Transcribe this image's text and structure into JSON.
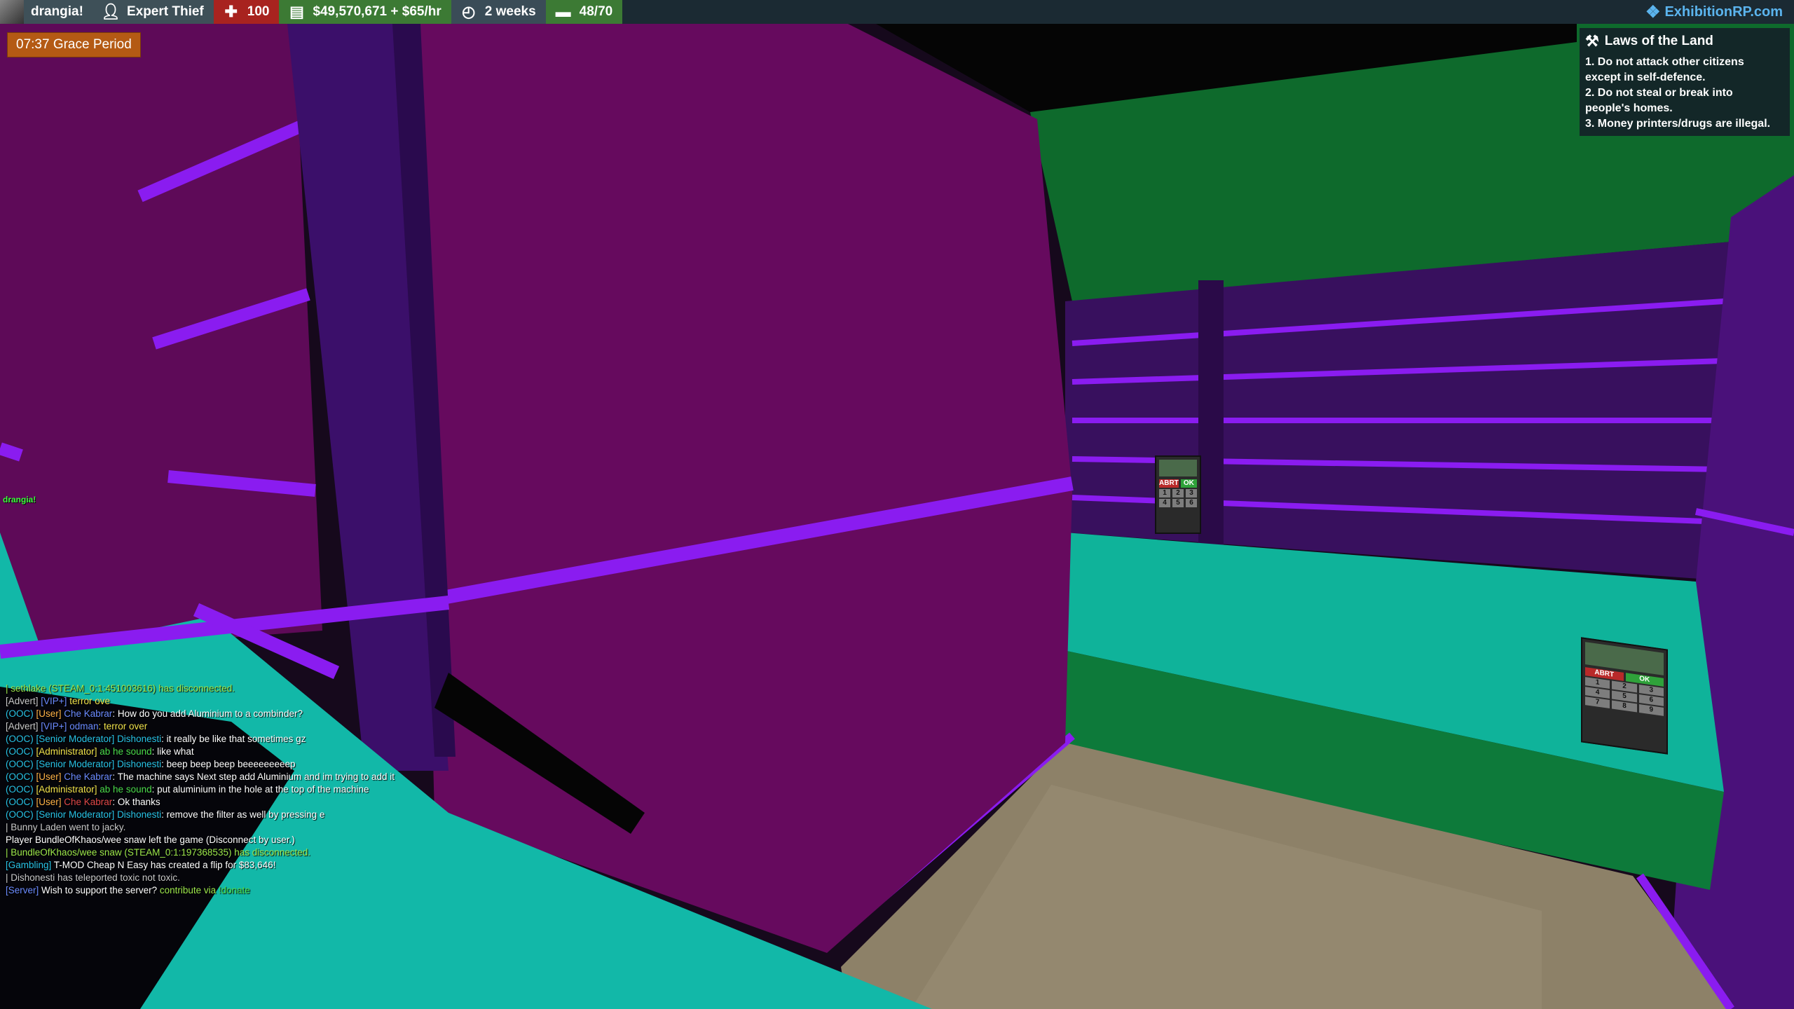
{
  "hud": {
    "player_name": "drangia!",
    "job": "Expert Thief",
    "health": "100",
    "money": "$49,570,671 + $65/hr",
    "playtime": "2 weeks",
    "slots": "48/70",
    "brand": "ExhibitionRP.com",
    "icons": {
      "job": "person-icon",
      "health": "health-cross-icon",
      "money": "wallet-icon",
      "time": "clock-icon",
      "slots": "bed-icon",
      "brand": "shield-logo-icon"
    }
  },
  "grace_period": "07:37 Grace Period",
  "laws": {
    "title": "Laws of the Land",
    "lines": [
      "1. Do not attack other citizens",
      "except in self-defence.",
      "2. Do not steal or break into",
      "people's homes.",
      "3. Money printers/drugs are illegal."
    ]
  },
  "player_tag": "drangia!",
  "keypad_labels": {
    "clear": "ABRT",
    "ok": "OK",
    "keys": [
      "1",
      "2",
      "3",
      "4",
      "5",
      "6",
      "7",
      "8",
      "9"
    ]
  },
  "chat": [
    [
      {
        "t": "| sethlake (STEAM_0:1:451003616) has disconnected.",
        "c": "c-lime"
      }
    ],
    [
      {
        "t": "[Advert] ",
        "c": "c-grey"
      },
      {
        "t": "[VIP+] ",
        "c": "c-blue"
      },
      {
        "t": "terror ove",
        "c": "c-yellow"
      }
    ],
    [
      {
        "t": "(OOC) ",
        "c": "c-cyan"
      },
      {
        "t": "[User] ",
        "c": "c-orange"
      },
      {
        "t": "Che Kabrar",
        "c": "c-blue"
      },
      {
        "t": ": How do you add Aluminium to a combinder?",
        "c": "c-white"
      }
    ],
    [
      {
        "t": "[Advert] ",
        "c": "c-grey"
      },
      {
        "t": "[VIP+] ",
        "c": "c-blue"
      },
      {
        "t": "odman",
        "c": "c-blue"
      },
      {
        "t": ": terror over",
        "c": "c-yellow"
      }
    ],
    [
      {
        "t": "(OOC) ",
        "c": "c-cyan"
      },
      {
        "t": "[Senior Moderator] ",
        "c": "c-cyan"
      },
      {
        "t": "Dishonesti",
        "c": "c-cyan"
      },
      {
        "t": ": it really be like that sometimes gz",
        "c": "c-white"
      }
    ],
    [
      {
        "t": "(OOC) ",
        "c": "c-cyan"
      },
      {
        "t": "[Administrator] ",
        "c": "c-yellow"
      },
      {
        "t": "ab he sound",
        "c": "c-green"
      },
      {
        "t": ": like what",
        "c": "c-white"
      }
    ],
    [
      {
        "t": "(OOC) ",
        "c": "c-cyan"
      },
      {
        "t": "[Senior Moderator] ",
        "c": "c-cyan"
      },
      {
        "t": "Dishonesti",
        "c": "c-cyan"
      },
      {
        "t": ": beep beep beep beeeeeeeeep",
        "c": "c-white"
      }
    ],
    [
      {
        "t": "(OOC) ",
        "c": "c-cyan"
      },
      {
        "t": "[User] ",
        "c": "c-orange"
      },
      {
        "t": "Che Kabrar",
        "c": "c-blue"
      },
      {
        "t": ": The machine says Next step add Aluminium and im trying to add it",
        "c": "c-white"
      }
    ],
    [
      {
        "t": "(OOC) ",
        "c": "c-cyan"
      },
      {
        "t": "[Administrator] ",
        "c": "c-yellow"
      },
      {
        "t": "ab he sound",
        "c": "c-green"
      },
      {
        "t": ": put aluminium in the hole at the top of the machine",
        "c": "c-white"
      }
    ],
    [
      {
        "t": "(OOC) ",
        "c": "c-cyan"
      },
      {
        "t": "[User] ",
        "c": "c-orange"
      },
      {
        "t": "Che Kabrar",
        "c": "c-red"
      },
      {
        "t": ": Ok thanks",
        "c": "c-white"
      }
    ],
    [
      {
        "t": "(OOC) ",
        "c": "c-cyan"
      },
      {
        "t": "[Senior Moderator] ",
        "c": "c-cyan"
      },
      {
        "t": "Dishonesti",
        "c": "c-cyan"
      },
      {
        "t": ": remove the filter as well by pressing e",
        "c": "c-white"
      }
    ],
    [
      {
        "t": "| Bunny Laden went to jacky.",
        "c": "c-grey"
      }
    ],
    [
      {
        "t": "Player BundleOfKhaos/wee snaw left the game (Disconnect by user.)",
        "c": "c-white"
      }
    ],
    [
      {
        "t": "| BundleOfKhaos/wee snaw (STEAM_0:1:197368535) has disconnected.",
        "c": "c-lime"
      }
    ],
    [
      {
        "t": "[Gambling] ",
        "c": "c-cyan"
      },
      {
        "t": "T-MOD Cheap N Easy has created a flip for $83,646!",
        "c": "c-white"
      }
    ],
    [
      {
        "t": "| Dishonesti has teleported toxic not toxic.",
        "c": "c-grey"
      }
    ],
    [
      {
        "t": "[Server] ",
        "c": "c-blue"
      },
      {
        "t": "Wish to support the server? ",
        "c": "c-white"
      },
      {
        "t": "contribute via ",
        "c": "c-lime"
      },
      {
        "t": "!donate",
        "c": "c-green"
      }
    ]
  ]
}
